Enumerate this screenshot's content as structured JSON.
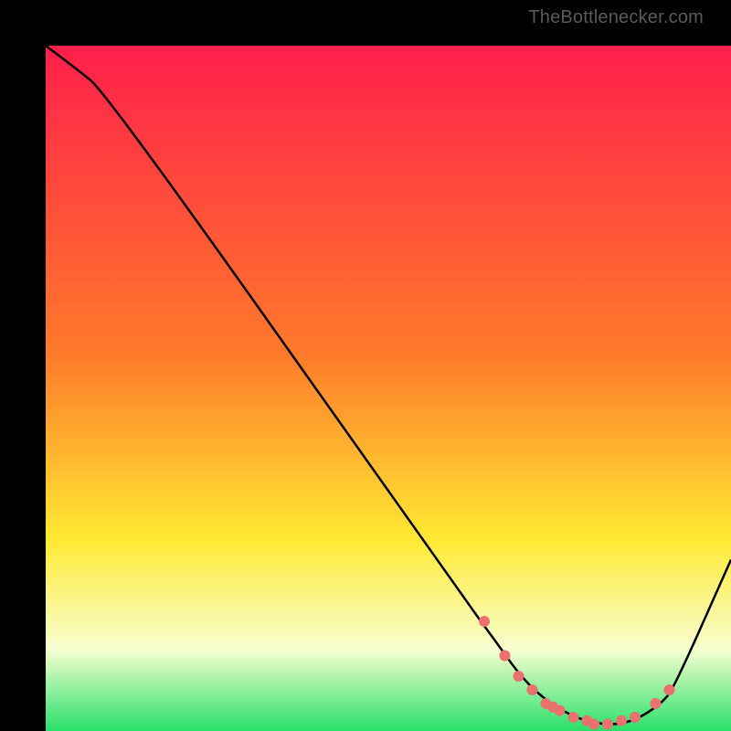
{
  "attribution": "TheBottlenecker.com",
  "colors": {
    "top": "#ff1f4b",
    "mid1": "#ff7a2a",
    "mid2": "#ffe933",
    "pale": "#f8ffd0",
    "green": "#28e06a",
    "curve": "#000000",
    "marker": "#e9716e"
  },
  "chart_data": {
    "type": "line",
    "title": "",
    "xlabel": "",
    "ylabel": "",
    "xlim": [
      0,
      100
    ],
    "ylim": [
      0,
      100
    ],
    "x": [
      0,
      4,
      9,
      62,
      65,
      70,
      75,
      80,
      85,
      90,
      92,
      100
    ],
    "y": [
      100,
      97,
      93,
      18,
      14,
      7,
      3,
      1,
      1,
      4,
      7,
      25
    ],
    "markers": {
      "x": [
        64,
        67,
        69,
        71,
        73,
        74,
        75,
        77,
        79,
        80,
        82,
        84,
        86,
        89,
        91
      ],
      "y": [
        16,
        11,
        8,
        6,
        4,
        3.5,
        3,
        2,
        1.5,
        1,
        1,
        1.5,
        2,
        4,
        6
      ]
    },
    "gradient_stops": [
      {
        "offset": 0.0,
        "key": "top"
      },
      {
        "offset": 0.45,
        "key": "mid1"
      },
      {
        "offset": 0.72,
        "key": "mid2"
      },
      {
        "offset": 0.88,
        "key": "pale"
      },
      {
        "offset": 1.0,
        "key": "green"
      }
    ]
  }
}
